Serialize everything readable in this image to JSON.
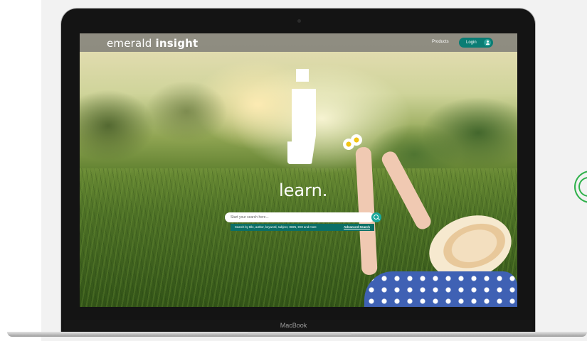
{
  "header": {
    "brand_light": "emerald",
    "brand_bold": "insight",
    "products_label": "Products",
    "login_label": "Login"
  },
  "hero": {
    "icon_letter": "i",
    "tagline": "learn."
  },
  "search": {
    "placeholder": "Start your search here...",
    "help_text": "Search by title, author, keyword, subject, ISBN, DOI and more",
    "advanced_label": "Advanced Search"
  },
  "device": {
    "brand": "MacBook"
  },
  "colors": {
    "accent": "#0a7d74",
    "search_bar": "#0b6f67",
    "side_icon": "#2fb14b"
  },
  "icons": {
    "search": "search-icon",
    "user": "user-icon",
    "side": "side-arc-icon"
  }
}
